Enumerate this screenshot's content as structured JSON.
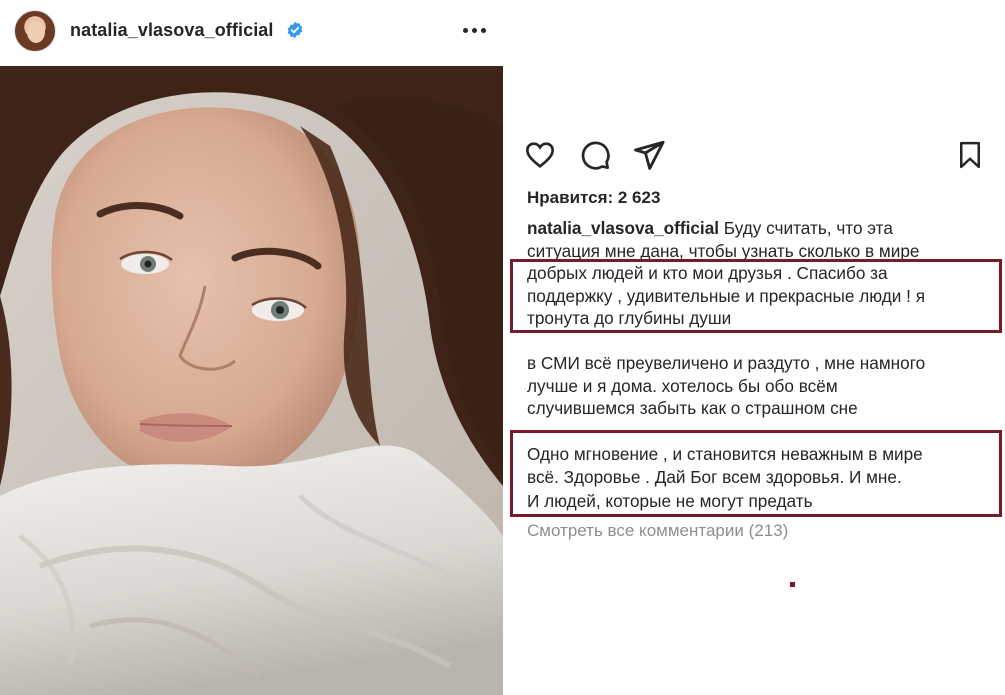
{
  "post": {
    "username": "natalia_vlasova_official",
    "verified": true,
    "likes_label": "Нравится: 2 623",
    "caption_user": "natalia_vlasova_official",
    "caption_line1": " Буду считать, что эта",
    "caption_line2": "ситуация мне дана, чтобы узнать сколько в мире",
    "caption_line3": "добрых людей и кто мои друзья . Спасибо за",
    "caption_line4": "поддержку , удивительные и прекрасные люди ! я",
    "caption_line5": "тронута до глубины души",
    "para2_line1": "в СМИ всё преувеличено и раздуто , мне намного",
    "para2_line2": "лучше и я дома.  хотелось бы обо всём",
    "para2_line3": "случившемся забыть как о страшном сне",
    "para3_line1": "Одно мгновение , и становится неважным в мире",
    "para3_line2": "всё. Здоровье . Дай Бог всем здоровья. И мне.",
    "para3_line3": "И людей, которые не могут предать",
    "view_comments": "Смотреть все комментарии (213)"
  },
  "icons": {
    "like": "heart-icon",
    "comment": "comment-icon",
    "share": "send-icon",
    "save": "bookmark-icon",
    "more": "more-icon",
    "verified": "verified-badge-icon"
  },
  "colors": {
    "highlight_border": "#7a1a2a",
    "verified_blue": "#3897f0",
    "muted_text": "#8e8e8e"
  }
}
